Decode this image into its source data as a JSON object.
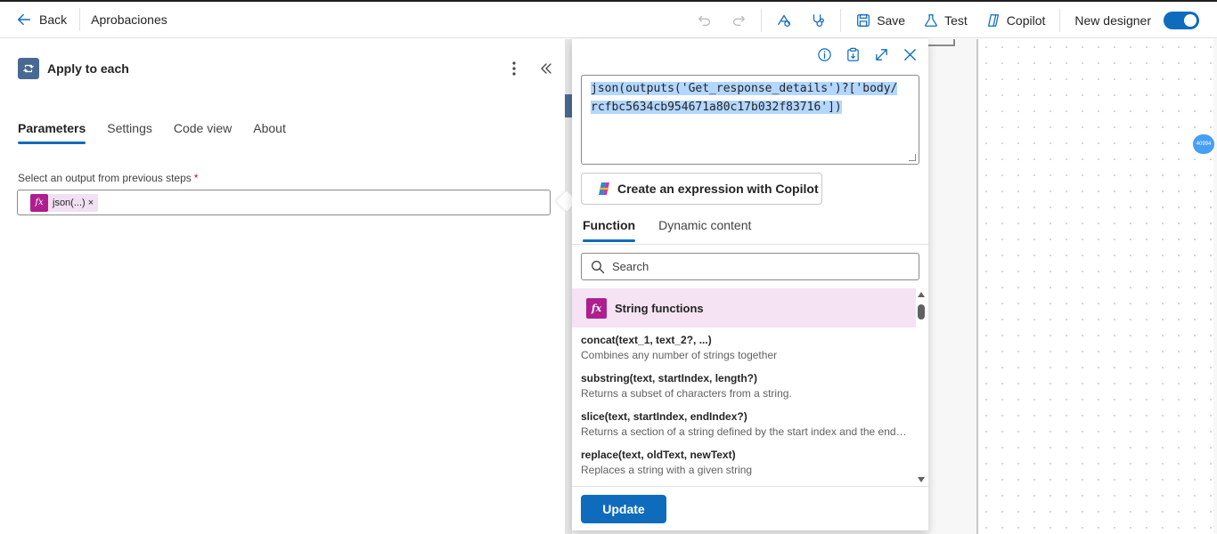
{
  "topbar": {
    "back_label": "Back",
    "flow_name": "Aprobaciones",
    "save_label": "Save",
    "test_label": "Test",
    "copilot_label": "Copilot",
    "new_designer_label": "New designer",
    "new_designer_enabled": true
  },
  "action": {
    "title": "Apply to each",
    "icon": "loop-icon",
    "color": "#486991"
  },
  "panel_tabs": [
    {
      "label": "Parameters",
      "active": true
    },
    {
      "label": "Settings",
      "active": false
    },
    {
      "label": "Code view",
      "active": false
    },
    {
      "label": "About",
      "active": false
    }
  ],
  "field": {
    "label": "Select an output from previous steps",
    "required_mark": "*",
    "token_icon": "fx",
    "token_label": "json(...)",
    "token_remove": "×"
  },
  "canvas": {
    "badge_text": "40994"
  },
  "popover": {
    "expression_line1": "json(outputs('Get_response_details')?['body/",
    "expression_line2": "rcfbc5634cb954671a80c17b032f83716'])",
    "copilot_button": "Create an expression with Copilot",
    "tabs": [
      {
        "label": "Function",
        "active": true
      },
      {
        "label": "Dynamic content",
        "active": false
      }
    ],
    "search_placeholder": "Search",
    "group_label": "String functions",
    "group_icon": "fx",
    "functions": [
      {
        "signature": "concat(text_1, text_2?, ...)",
        "description": "Combines any number of strings together"
      },
      {
        "signature": "substring(text, startIndex, length?)",
        "description": "Returns a subset of characters from a string."
      },
      {
        "signature": "slice(text, startIndex, endIndex?)",
        "description": "Returns a section of a string defined by the start index and the end index."
      },
      {
        "signature": "replace(text, oldText, newText)",
        "description": "Replaces a string with a given string"
      }
    ],
    "update_button": "Update"
  },
  "colors": {
    "accent": "#0f6cbd",
    "fx_token": "#ae1e8f",
    "group_bg": "#f5e3f3"
  }
}
